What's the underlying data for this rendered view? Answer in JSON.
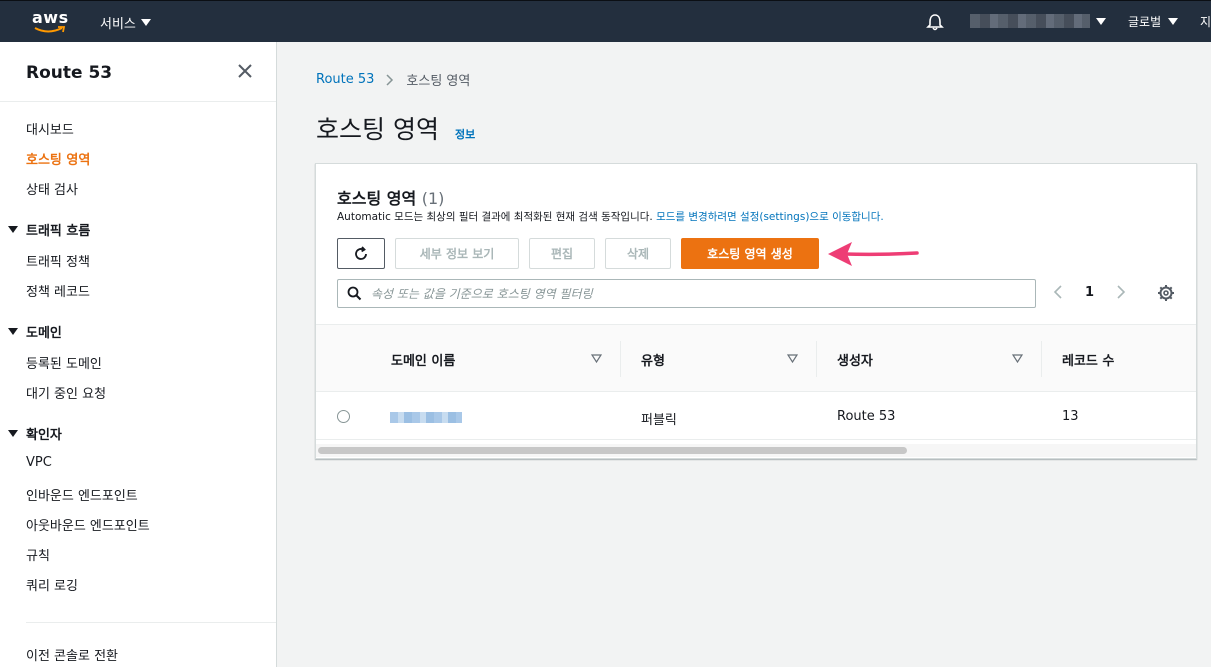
{
  "topnav": {
    "logo_text": "aws",
    "services_label": "서비스",
    "region_label": "글로벌",
    "support_label": "지"
  },
  "sidebar": {
    "title": "Route 53",
    "items": [
      {
        "label": "대시보드"
      },
      {
        "label": "호스팅 영역",
        "active": true
      },
      {
        "label": "상태 검사"
      }
    ],
    "sections": [
      {
        "label": "트래픽 흐름",
        "items": [
          "트래픽 정책",
          "정책 레코드"
        ]
      },
      {
        "label": "도메인",
        "items": [
          "등록된 도메인",
          "대기 중인 요청"
        ]
      },
      {
        "label": "확인자",
        "items": [
          "VPC",
          "인바운드 엔드포인트",
          "아웃바운드 엔드포인트",
          "규칙",
          "쿼리 로깅"
        ]
      }
    ],
    "footer_link": "이전 콘솔로 전환"
  },
  "breadcrumb": {
    "root": "Route 53",
    "current": "호스팅 영역"
  },
  "page": {
    "title": "호스팅 영역",
    "info": "정보"
  },
  "panel": {
    "title": "호스팅 영역",
    "count": "(1)",
    "desc_prefix": "Automatic 모드는 최상의 필터 결과에 최적화된 현재 검색 동작입니다. ",
    "desc_link": "모드를 변경하려면 설정(settings)으로 이동합니다.",
    "buttons": {
      "details": "세부 정보 보기",
      "edit": "편집",
      "delete": "삭제",
      "create": "호스팅 영역 생성"
    },
    "search_placeholder": "속성 또는 값을 기준으로 호스팅 영역 필터링",
    "page_number": "1",
    "columns": [
      "도메인 이름",
      "유형",
      "생성자",
      "레코드 수"
    ],
    "rows": [
      {
        "type": "퍼블릭",
        "created_by": "Route 53",
        "record_count": "13"
      }
    ]
  },
  "colors": {
    "nav_bg": "#232f3e",
    "accent": "#ec7211",
    "link": "#0073bb",
    "annotation_arrow": "#ee3d75"
  }
}
